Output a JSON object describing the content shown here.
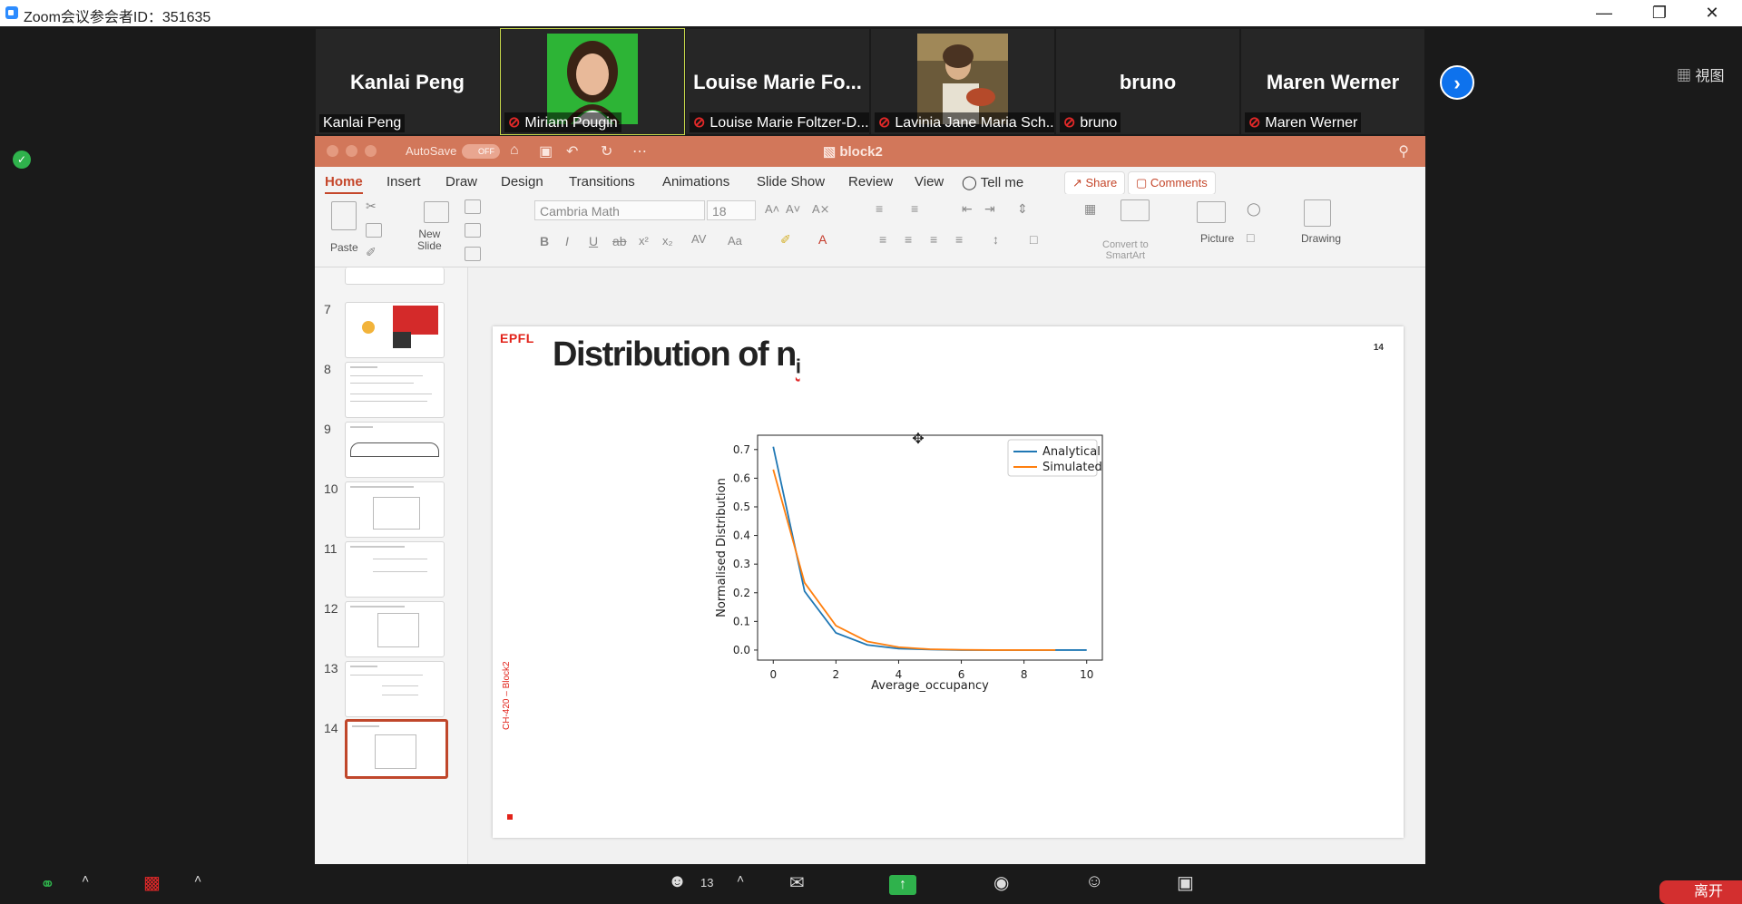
{
  "window": {
    "title": "Zoom会议参会者ID：351635"
  },
  "view_button": "視图",
  "participants": [
    {
      "big_name": "Kanlai Peng",
      "label": "Kanlai Peng",
      "muted": false,
      "video": false
    },
    {
      "big_name": "",
      "label": "Miriam Pougin",
      "muted": true,
      "video": true
    },
    {
      "big_name": "Louise Marie Fo...",
      "label": "Louise Marie Foltzer-D...",
      "muted": true,
      "video": false
    },
    {
      "big_name": "",
      "label": "Lavinia Jane Maria Sch...",
      "muted": true,
      "video": true
    },
    {
      "big_name": "bruno",
      "label": "bruno",
      "muted": true,
      "video": false
    },
    {
      "big_name": "Maren Werner",
      "label": "Maren Werner",
      "muted": true,
      "video": false
    }
  ],
  "ppt": {
    "autosave_label": "AutoSave",
    "autosave_state": "OFF",
    "doc_name": "block2",
    "tabs": [
      "Home",
      "Insert",
      "Draw",
      "Design",
      "Transitions",
      "Animations",
      "Slide Show",
      "Review",
      "View"
    ],
    "tell_me": "Tell me",
    "share": "Share",
    "comments": "Comments",
    "ribbon": {
      "paste": "Paste",
      "new_slide": "New\nSlide",
      "font": "Cambria Math",
      "font_size": "18",
      "convert": "Convert to\nSmartArt",
      "picture": "Picture",
      "drawing": "Drawing"
    },
    "thumb_numbers": [
      "7",
      "8",
      "9",
      "10",
      "11",
      "12",
      "13",
      "14"
    ],
    "slide": {
      "logo": "EPFL",
      "title": "Distribution of n",
      "title_sub": "i",
      "page": "14",
      "side_text": "CH-420 – Block2"
    }
  },
  "chart_data": {
    "type": "line",
    "xlabel": "Average_occupancy",
    "ylabel": "Normalised Distribution",
    "xlim": [
      -0.5,
      10.5
    ],
    "ylim": [
      -0.035,
      0.75
    ],
    "xticks": [
      0,
      2,
      4,
      6,
      8,
      10
    ],
    "yticks": [
      0.0,
      0.1,
      0.2,
      0.3,
      0.4,
      0.5,
      0.6,
      0.7
    ],
    "legend": "top-right",
    "series": [
      {
        "name": "Analytical",
        "color": "#1f77b4",
        "x": [
          0,
          1,
          2,
          3,
          4,
          5,
          6,
          7,
          8,
          9,
          10
        ],
        "y": [
          0.71,
          0.205,
          0.06,
          0.018,
          0.005,
          0.002,
          0.0,
          0.0,
          0.0,
          0.0,
          0.0
        ]
      },
      {
        "name": "Simulated",
        "color": "#ff7f0e",
        "x": [
          0,
          1,
          2,
          3,
          4,
          5,
          6,
          7,
          8,
          9
        ],
        "y": [
          0.63,
          0.235,
          0.085,
          0.03,
          0.01,
          0.003,
          0.001,
          0.0,
          0.0,
          0.0
        ]
      }
    ]
  },
  "bottombar": {
    "participant_count": "13",
    "leave": "离开"
  }
}
